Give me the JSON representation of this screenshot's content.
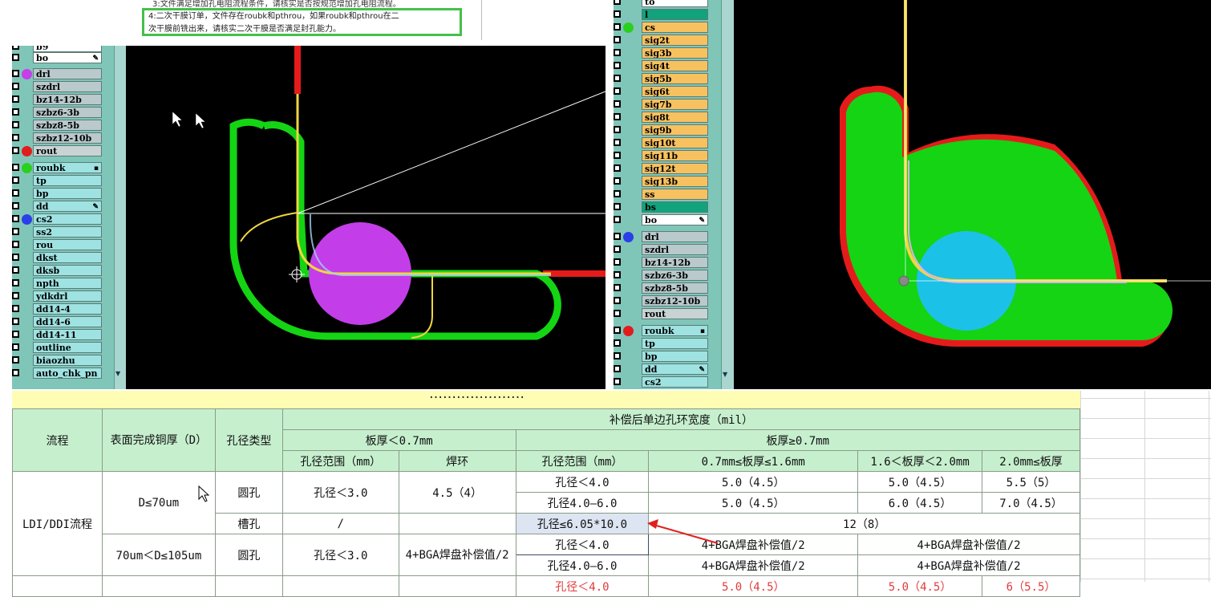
{
  "doc": {
    "line3": "3:文件满足增加孔电阻流程条件，请核实是否按规范增加孔电阻流程。",
    "note_line1": "4:二次干膜订单，文件存在roubk和pthrou，如果roubk和pthrou在二",
    "note_line2": "次干膜前铣出来，请核实二次干膜是否满足封孔能力。"
  },
  "left_panel": {
    "layers": [
      {
        "label": "b9",
        "style": "l-white",
        "dot": ""
      },
      {
        "label": "bo",
        "style": "l-white",
        "dot": "",
        "mark": "✎"
      },
      {
        "label": "drl",
        "style": "l-grey",
        "dot": "#c63fe8"
      },
      {
        "label": "szdrl",
        "style": "l-grey",
        "dot": ""
      },
      {
        "label": "bz14-12b",
        "style": "l-grey",
        "dot": ""
      },
      {
        "label": "szbz6-3b",
        "style": "l-grey",
        "dot": ""
      },
      {
        "label": "szbz8-5b",
        "style": "l-grey",
        "dot": ""
      },
      {
        "label": "szbz12-10b",
        "style": "l-grey",
        "dot": ""
      },
      {
        "label": "rout",
        "style": "l-gray2",
        "dot": "#e21c1c"
      },
      {
        "label": "roubk",
        "style": "l-cyan",
        "dot": "#2bd01e",
        "mark": "▪"
      },
      {
        "label": "tp",
        "style": "l-cyan",
        "dot": ""
      },
      {
        "label": "bp",
        "style": "l-cyan",
        "dot": ""
      },
      {
        "label": "dd",
        "style": "l-cyan",
        "dot": "",
        "mark": "✎"
      },
      {
        "label": "cs2",
        "style": "l-cyan",
        "dot": "#2a3fe8"
      },
      {
        "label": "ss2",
        "style": "l-cyan",
        "dot": ""
      },
      {
        "label": "rou",
        "style": "l-cyan",
        "dot": ""
      },
      {
        "label": "dkst",
        "style": "l-cyan",
        "dot": ""
      },
      {
        "label": "dksb",
        "style": "l-cyan",
        "dot": ""
      },
      {
        "label": "npth",
        "style": "l-cyan",
        "dot": ""
      },
      {
        "label": "ydkdrl",
        "style": "l-cyan",
        "dot": ""
      },
      {
        "label": "dd14-4",
        "style": "l-cyan",
        "dot": ""
      },
      {
        "label": "dd14-6",
        "style": "l-cyan",
        "dot": ""
      },
      {
        "label": "dd14-11",
        "style": "l-cyan",
        "dot": ""
      },
      {
        "label": "outline",
        "style": "l-cyan",
        "dot": ""
      },
      {
        "label": "biaozhu",
        "style": "l-cyan",
        "dot": ""
      },
      {
        "label": "auto_chk_pn",
        "style": "l-cyan",
        "dot": ""
      }
    ]
  },
  "right_panel": {
    "layers": [
      {
        "label": "to",
        "style": "l-white",
        "dot": ""
      },
      {
        "label": "l",
        "style": "l-teal",
        "dot": ""
      },
      {
        "label": "cs",
        "style": "l-orange",
        "dot": "#2bd01e"
      },
      {
        "label": "sig2t",
        "style": "l-orange",
        "dot": ""
      },
      {
        "label": "sig3b",
        "style": "l-orange",
        "dot": ""
      },
      {
        "label": "sig4t",
        "style": "l-orange",
        "dot": ""
      },
      {
        "label": "sig5b",
        "style": "l-orange",
        "dot": ""
      },
      {
        "label": "sig6t",
        "style": "l-orange",
        "dot": ""
      },
      {
        "label": "sig7b",
        "style": "l-orange",
        "dot": ""
      },
      {
        "label": "sig8t",
        "style": "l-orange",
        "dot": ""
      },
      {
        "label": "sig9b",
        "style": "l-orange",
        "dot": ""
      },
      {
        "label": "sig10t",
        "style": "l-orange",
        "dot": ""
      },
      {
        "label": "sig11b",
        "style": "l-orange",
        "dot": ""
      },
      {
        "label": "sig12t",
        "style": "l-orange",
        "dot": ""
      },
      {
        "label": "sig13b",
        "style": "l-orange",
        "dot": ""
      },
      {
        "label": "ss",
        "style": "l-orange",
        "dot": ""
      },
      {
        "label": "bs",
        "style": "l-teal",
        "dot": ""
      },
      {
        "label": "bo",
        "style": "l-white",
        "dot": "",
        "mark": "✎"
      },
      {
        "label": "drl",
        "style": "l-grey",
        "dot": "#2a3fe8"
      },
      {
        "label": "szdrl",
        "style": "l-grey",
        "dot": ""
      },
      {
        "label": "bz14-12b",
        "style": "l-grey",
        "dot": ""
      },
      {
        "label": "szbz6-3b",
        "style": "l-grey",
        "dot": ""
      },
      {
        "label": "szbz8-5b",
        "style": "l-grey",
        "dot": ""
      },
      {
        "label": "szbz12-10b",
        "style": "l-grey",
        "dot": ""
      },
      {
        "label": "rout",
        "style": "l-gray2",
        "dot": ""
      },
      {
        "label": "roubk",
        "style": "l-cyan",
        "dot": "#e21c1c",
        "mark": "▪"
      },
      {
        "label": "tp",
        "style": "l-cyan",
        "dot": ""
      },
      {
        "label": "bp",
        "style": "l-cyan",
        "dot": ""
      },
      {
        "label": "dd",
        "style": "l-cyan",
        "dot": "",
        "mark": "✎"
      },
      {
        "label": "cs2",
        "style": "l-cyan",
        "dot": ""
      }
    ]
  },
  "colors": {
    "route_green": "#14d414",
    "route_red": "#e51b1b",
    "trace_yellow": "#f0d640",
    "drill_magenta": "#c33ee8",
    "drill_cyan": "#1cc1e8",
    "header_green": "#c6efce",
    "arrow_red": "#e02020"
  },
  "table": {
    "title_fragment": "…………………",
    "h_flow": "流程",
    "h_cu": "表面完成铜厚（D）",
    "h_hole_type": "孔径类型",
    "h_comp": "补偿后单边孔环宽度（mil）",
    "h_thin": "板厚＜0.7mm",
    "h_thick": "板厚≥0.7mm",
    "h_range1": "孔径范围（mm）",
    "h_ring": "焊环",
    "h_range2": "孔径范围（mm）",
    "h_t1": "0.7mm≤板厚≤1.6mm",
    "h_t2": "1.6＜板厚＜2.0mm",
    "h_t3": "2.0mm≤板厚",
    "flow_ldi": "LDI/DDI流程",
    "cu1": "D≤70um",
    "cu2": "70um＜D≤105um",
    "round_hole": "圆孔",
    "slot_hole": "槽孔",
    "r1_range": "孔径＜3.0",
    "r1_ring": "4.5（4）",
    "r1a_range": "孔径＜4.0",
    "r1a_t1": "5.0（4.5）",
    "r1a_t2": "5.0（4.5）",
    "r1a_t3": "5.5（5）",
    "r1b_range": "孔径4.0—6.0",
    "r1b_t1": "5.0（4.5）",
    "r1b_t2": "6.0（4.5）",
    "r1b_t3": "7.0（4.5）",
    "slot_range": "/",
    "slot_thick_range": "孔径≤6.05*10.0",
    "slot_val": "12（8）",
    "r2_range": "孔径＜3.0",
    "r2_ring": "4+BGA焊盘补偿值/2",
    "r2a_range": "孔径＜4.0",
    "r2a_t1": "4+BGA焊盘补偿值/2",
    "r2a_t23": "4+BGA焊盘补偿值/2",
    "r2b_range": "孔径4.0—6.0",
    "r2b_t1": "4+BGA焊盘补偿值/2",
    "r2b_t23": "4+BGA焊盘补偿值/2",
    "r3_range": "孔径＜4.0",
    "r3_t1": "5.0（4.5）",
    "r3_t2": "5.0（4.5）",
    "r3_t3": "6（5.5）"
  }
}
